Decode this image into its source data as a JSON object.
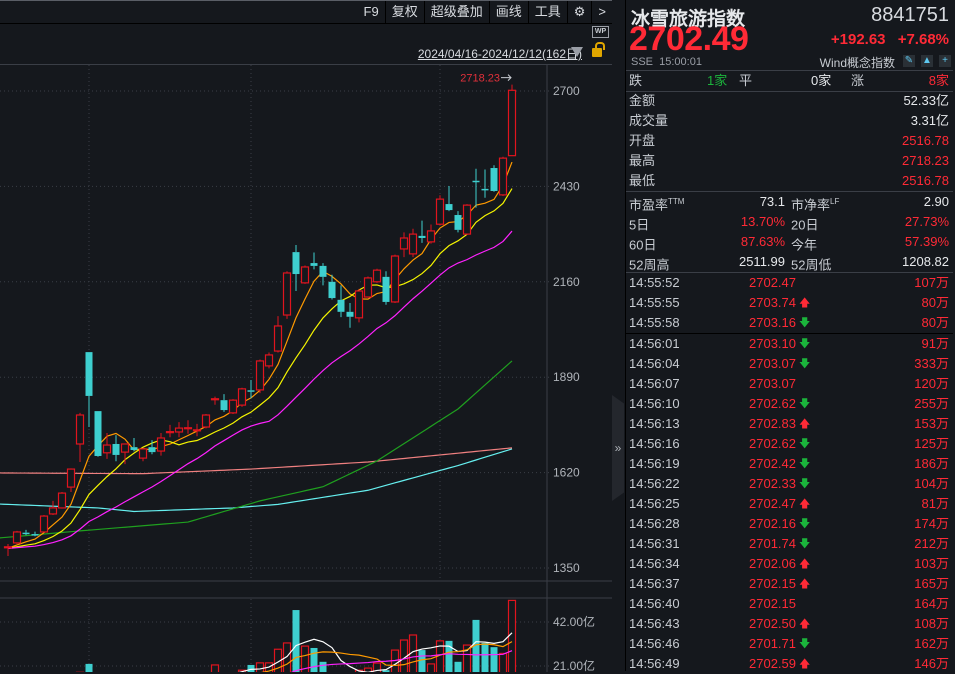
{
  "toolbar": {
    "items": [
      "F9",
      "复权",
      "超级叠加",
      "画线",
      "工具"
    ],
    "gear": "gear-icon",
    "more": ">"
  },
  "chart_header": {
    "date_range": "2024/04/16-2024/12/12(162日)",
    "wp_label": "WP"
  },
  "quote": {
    "name": "冰雪旅游指数",
    "code": "8841751",
    "price": "2702.49",
    "change": "+192.63",
    "change_pct": "+7.68%",
    "exchange": "SSE",
    "time": "15:00:01",
    "category": "Wind概念指数"
  },
  "breadth": {
    "down_label": "跌",
    "down": "1家",
    "flat_label": "平",
    "flat": "0家",
    "up_label": "涨",
    "up": "8家"
  },
  "stats": [
    {
      "label": "金额",
      "value": "52.33亿",
      "color": "wht"
    },
    {
      "label": "成交量",
      "value": "3.31亿",
      "color": "wht"
    },
    {
      "label": "开盘",
      "value": "2516.78",
      "color": "red"
    },
    {
      "label": "最高",
      "value": "2718.23",
      "color": "red"
    },
    {
      "label": "最低",
      "value": "2516.78",
      "color": "red"
    }
  ],
  "valuation": [
    {
      "l1": "市盈率",
      "sup1": "TTM",
      "v1": "73.1",
      "c1": "wht",
      "l2": "市净率",
      "sup2": "LF",
      "v2": "2.90",
      "c2": "wht"
    },
    {
      "l1": "5日",
      "sup1": "",
      "v1": "13.70%",
      "c1": "red",
      "l2": "20日",
      "sup2": "",
      "v2": "27.73%",
      "c2": "red"
    },
    {
      "l1": "60日",
      "sup1": "",
      "v1": "87.63%",
      "c1": "red",
      "l2": "今年",
      "sup2": "",
      "v2": "57.39%",
      "c2": "red"
    },
    {
      "l1": "52周高",
      "sup1": "",
      "v1": "2511.99",
      "c1": "wht",
      "l2": "52周低",
      "sup2": "",
      "v2": "1208.82",
      "c2": "wht"
    }
  ],
  "ticks": [
    {
      "time": "14:55:52",
      "price": "2702.47",
      "dir": "",
      "vol": "107万"
    },
    {
      "time": "14:55:55",
      "price": "2703.74",
      "dir": "up",
      "vol": "80万"
    },
    {
      "time": "14:55:58",
      "price": "2703.16",
      "dir": "down",
      "vol": "80万"
    },
    {
      "time": "14:56:01",
      "price": "2703.10",
      "dir": "down",
      "vol": "91万"
    },
    {
      "time": "14:56:04",
      "price": "2703.07",
      "dir": "down",
      "vol": "333万"
    },
    {
      "time": "14:56:07",
      "price": "2703.07",
      "dir": "",
      "vol": "120万"
    },
    {
      "time": "14:56:10",
      "price": "2702.62",
      "dir": "down",
      "vol": "255万"
    },
    {
      "time": "14:56:13",
      "price": "2702.83",
      "dir": "up",
      "vol": "153万"
    },
    {
      "time": "14:56:16",
      "price": "2702.62",
      "dir": "down",
      "vol": "125万"
    },
    {
      "time": "14:56:19",
      "price": "2702.42",
      "dir": "down",
      "vol": "186万"
    },
    {
      "time": "14:56:22",
      "price": "2702.33",
      "dir": "down",
      "vol": "104万"
    },
    {
      "time": "14:56:25",
      "price": "2702.47",
      "dir": "up",
      "vol": "81万"
    },
    {
      "time": "14:56:28",
      "price": "2702.16",
      "dir": "down",
      "vol": "174万"
    },
    {
      "time": "14:56:31",
      "price": "2701.74",
      "dir": "down",
      "vol": "212万"
    },
    {
      "time": "14:56:34",
      "price": "2702.06",
      "dir": "up",
      "vol": "103万"
    },
    {
      "time": "14:56:37",
      "price": "2702.15",
      "dir": "up",
      "vol": "165万"
    },
    {
      "time": "14:56:40",
      "price": "2702.15",
      "dir": "",
      "vol": "164万"
    },
    {
      "time": "14:56:43",
      "price": "2702.50",
      "dir": "up",
      "vol": "108万"
    },
    {
      "time": "14:56:46",
      "price": "2701.71",
      "dir": "down",
      "vol": "162万"
    },
    {
      "time": "14:56:49",
      "price": "2702.59",
      "dir": "up",
      "vol": "146万"
    }
  ],
  "colors": {
    "up": "#ff2a36",
    "down": "#1bb43c",
    "candle_up": "#e0141e",
    "candle_down": "#3ecfcf"
  },
  "chart_data": {
    "type": "candlestick",
    "y_ticks": [
      2700,
      2430,
      2160,
      1890,
      1620,
      1350
    ],
    "ylim": [
      1350,
      2700
    ],
    "high_label": "2718.23",
    "ohlc": [
      [
        1408,
        1418,
        1384,
        1410
      ],
      [
        1421,
        1455,
        1418,
        1452
      ],
      [
        1450,
        1458,
        1443,
        1448
      ],
      [
        1446,
        1453,
        1440,
        1444
      ],
      [
        1452,
        1500,
        1450,
        1497
      ],
      [
        1503,
        1540,
        1500,
        1520
      ],
      [
        1520,
        1565,
        1518,
        1562
      ],
      [
        1579,
        1632,
        1565,
        1630
      ],
      [
        1701,
        1789,
        1650,
        1783
      ],
      [
        1961,
        1961,
        1749,
        1837
      ],
      [
        1794,
        1794,
        1665,
        1667
      ],
      [
        1676,
        1732,
        1659,
        1698
      ],
      [
        1701,
        1726,
        1652,
        1670
      ],
      [
        1678,
        1701,
        1644,
        1701
      ],
      [
        1692,
        1718,
        1680,
        1684
      ],
      [
        1661,
        1690,
        1652,
        1687
      ],
      [
        1692,
        1712,
        1672,
        1678
      ],
      [
        1681,
        1732,
        1668,
        1718
      ],
      [
        1733,
        1755,
        1720,
        1736
      ],
      [
        1735,
        1763,
        1720,
        1746
      ],
      [
        1745,
        1768,
        1730,
        1747
      ],
      [
        1739,
        1758,
        1723,
        1741
      ],
      [
        1749,
        1786,
        1745,
        1783
      ],
      [
        1827,
        1835,
        1812,
        1829
      ],
      [
        1825,
        1842,
        1792,
        1797
      ],
      [
        1789,
        1828,
        1786,
        1825
      ],
      [
        1811,
        1860,
        1806,
        1857
      ],
      [
        1853,
        1882,
        1830,
        1849
      ],
      [
        1854,
        1940,
        1845,
        1936
      ],
      [
        1922,
        1960,
        1915,
        1953
      ],
      [
        1964,
        2063,
        1960,
        2035
      ],
      [
        2066,
        2190,
        2055,
        2185
      ],
      [
        2244,
        2264,
        2134,
        2182
      ],
      [
        2157,
        2206,
        2154,
        2202
      ],
      [
        2213,
        2243,
        2195,
        2205
      ],
      [
        2205,
        2213,
        2150,
        2174
      ],
      [
        2160,
        2180,
        2110,
        2114
      ],
      [
        2109,
        2150,
        2060,
        2075
      ],
      [
        2075,
        2100,
        2030,
        2061
      ],
      [
        2058,
        2140,
        2045,
        2134
      ],
      [
        2117,
        2175,
        2115,
        2171
      ],
      [
        2160,
        2197,
        2157,
        2193
      ],
      [
        2174,
        2190,
        2095,
        2103
      ],
      [
        2103,
        2237,
        2100,
        2233
      ],
      [
        2253,
        2300,
        2230,
        2284
      ],
      [
        2239,
        2310,
        2230,
        2295
      ],
      [
        2290,
        2333,
        2270,
        2284
      ],
      [
        2273,
        2322,
        2268,
        2304
      ],
      [
        2323,
        2405,
        2320,
        2394
      ],
      [
        2380,
        2431,
        2360,
        2363
      ],
      [
        2349,
        2360,
        2300,
        2307
      ],
      [
        2295,
        2380,
        2293,
        2377
      ],
      [
        2446,
        2480,
        2370,
        2444
      ],
      [
        2423,
        2478,
        2398,
        2421
      ],
      [
        2482,
        2490,
        2415,
        2417
      ],
      [
        2406,
        2514,
        2403,
        2510
      ],
      [
        2517,
        2718,
        2517,
        2702
      ]
    ],
    "ma_periods": [
      5,
      10,
      20
    ],
    "ma_colors": [
      "#ff9a00",
      "#f5f500",
      "#ff22ff"
    ],
    "long_ma": [
      {
        "color": "#f08080",
        "points": [
          [
            -1,
            1619
          ],
          [
            15,
            1617
          ],
          [
            27,
            1630
          ],
          [
            40,
            1650
          ],
          [
            56,
            1690
          ]
        ]
      },
      {
        "color": "#66f0f0",
        "points": [
          [
            -1,
            1531
          ],
          [
            10,
            1520
          ],
          [
            14,
            1510
          ],
          [
            25,
            1520
          ],
          [
            30,
            1530
          ],
          [
            40,
            1570
          ],
          [
            50,
            1640
          ],
          [
            56,
            1687
          ]
        ]
      },
      {
        "color": "#1fa01f",
        "points": [
          [
            -1,
            1435
          ],
          [
            8,
            1455
          ],
          [
            20,
            1480
          ],
          [
            28,
            1540
          ],
          [
            35,
            1580
          ],
          [
            41,
            1653
          ],
          [
            50,
            1800
          ],
          [
            56,
            1936
          ]
        ]
      }
    ],
    "volume_unit": "亿",
    "volume_ticks": [
      "42.00亿",
      "21.00亿"
    ],
    "volume_tick_values": [
      42,
      21
    ],
    "volume": [
      9,
      10,
      8,
      8,
      11,
      12,
      13,
      15,
      18,
      22,
      17,
      14,
      12,
      12,
      11,
      10,
      10,
      12,
      13,
      14,
      15,
      13,
      16,
      21.5,
      18,
      17,
      19,
      21.5,
      22.5,
      22.5,
      29,
      32,
      47.7,
      30.5,
      29.6,
      23,
      18,
      17,
      16,
      19,
      20,
      22.4,
      19,
      28.6,
      33.4,
      35.8,
      28.6,
      22,
      33,
      33,
      23,
      31,
      43,
      32,
      30,
      27,
      52.3
    ],
    "vol_ma_colors": [
      "#ffffff",
      "#ff9a00",
      "#ff22ff"
    ]
  }
}
